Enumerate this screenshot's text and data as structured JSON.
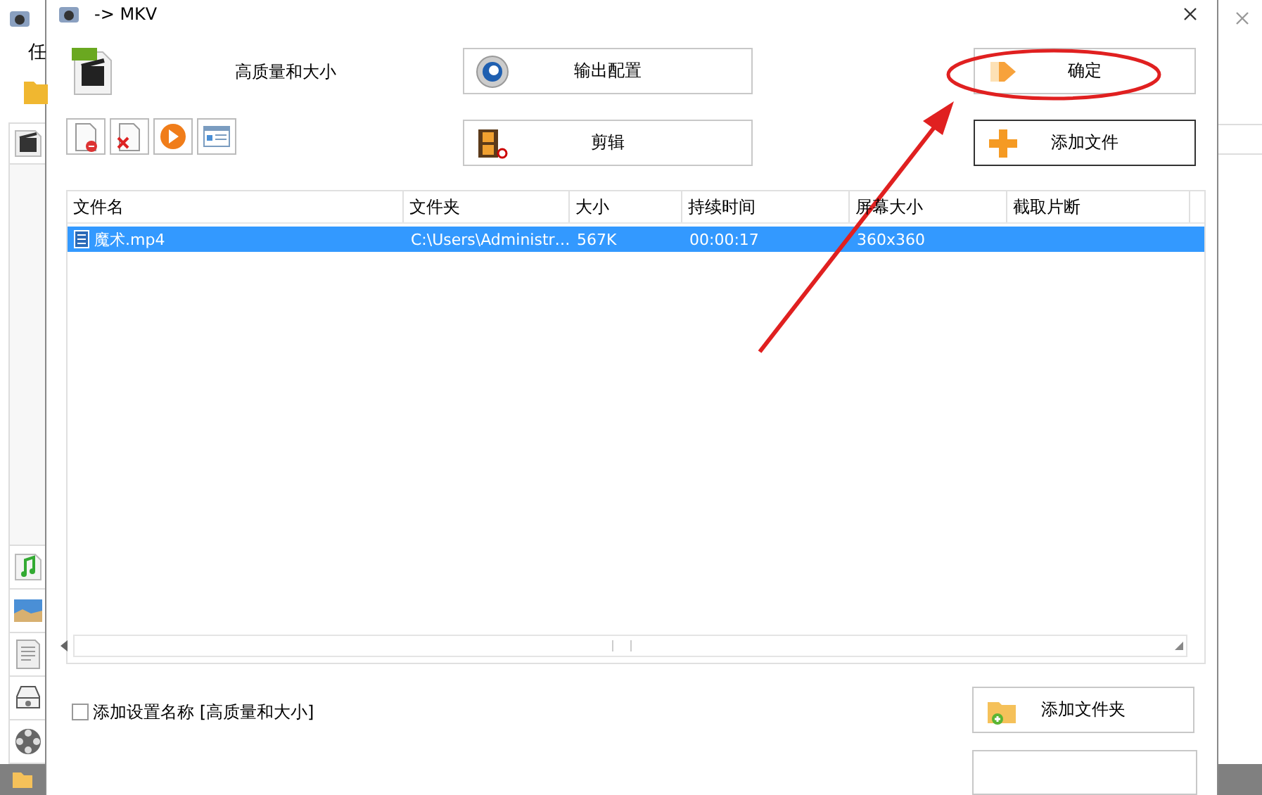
{
  "background_window": {
    "label": "任"
  },
  "window": {
    "title": "-> MKV"
  },
  "profile": {
    "name": "高质量和大小"
  },
  "buttons": [
    {
      "label": "输出配置",
      "focused": false
    },
    {
      "label": "确定",
      "focused": false
    },
    {
      "label": "剪辑",
      "focused": false
    },
    {
      "label": "添加文件",
      "focused": true
    }
  ],
  "table": {
    "columns": [
      "文件名",
      "文件夹",
      "大小",
      "持续时间",
      "屏幕大小",
      "截取片断"
    ],
    "rows": [
      {
        "cells": [
          "魔术.mp4",
          "C:\\Users\\Administr…",
          "567K",
          "00:00:17",
          "360x360"
        ],
        "selected": true
      }
    ]
  },
  "option": {
    "label": "添加设置名称 [高质量和大小]",
    "checked": false
  },
  "bottom_button": {
    "label": "添加文件夹",
    "focused": false
  }
}
